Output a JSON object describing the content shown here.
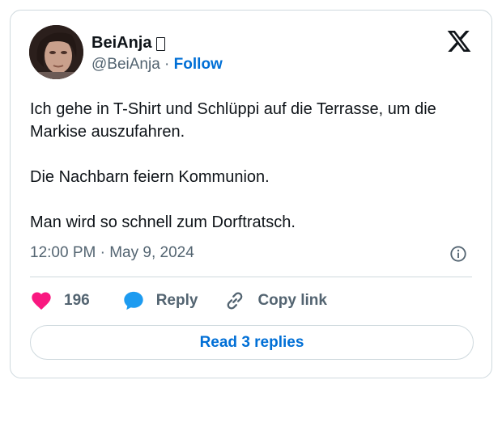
{
  "author": {
    "display_name": "BeiAnja",
    "handle": "@BeiAnja",
    "separator": " · ",
    "follow_label": "Follow",
    "avatar_icon": "avatar-photo"
  },
  "tweet": {
    "paragraphs": [
      "Ich gehe in T-Shirt und Schlüppi auf die Terrasse, um die Markise auszufahren.",
      "Die Nachbarn feiern Kommunion.",
      "Man wird so schnell zum Dorftratsch."
    ],
    "timestamp": "12:00 PM · May 9, 2024"
  },
  "actions": {
    "like_count": "196",
    "reply_label": "Reply",
    "copy_link_label": "Copy link"
  },
  "read_replies_label": "Read 3 replies",
  "colors": {
    "accent": "#006fd6",
    "like": "#f91880",
    "reply_bubble": "#1d9bf0",
    "secondary_text": "#536471",
    "border": "#cfd9de"
  },
  "icons": [
    "x-logo-icon",
    "info-icon",
    "heart-icon",
    "reply-bubble-icon",
    "link-icon"
  ]
}
